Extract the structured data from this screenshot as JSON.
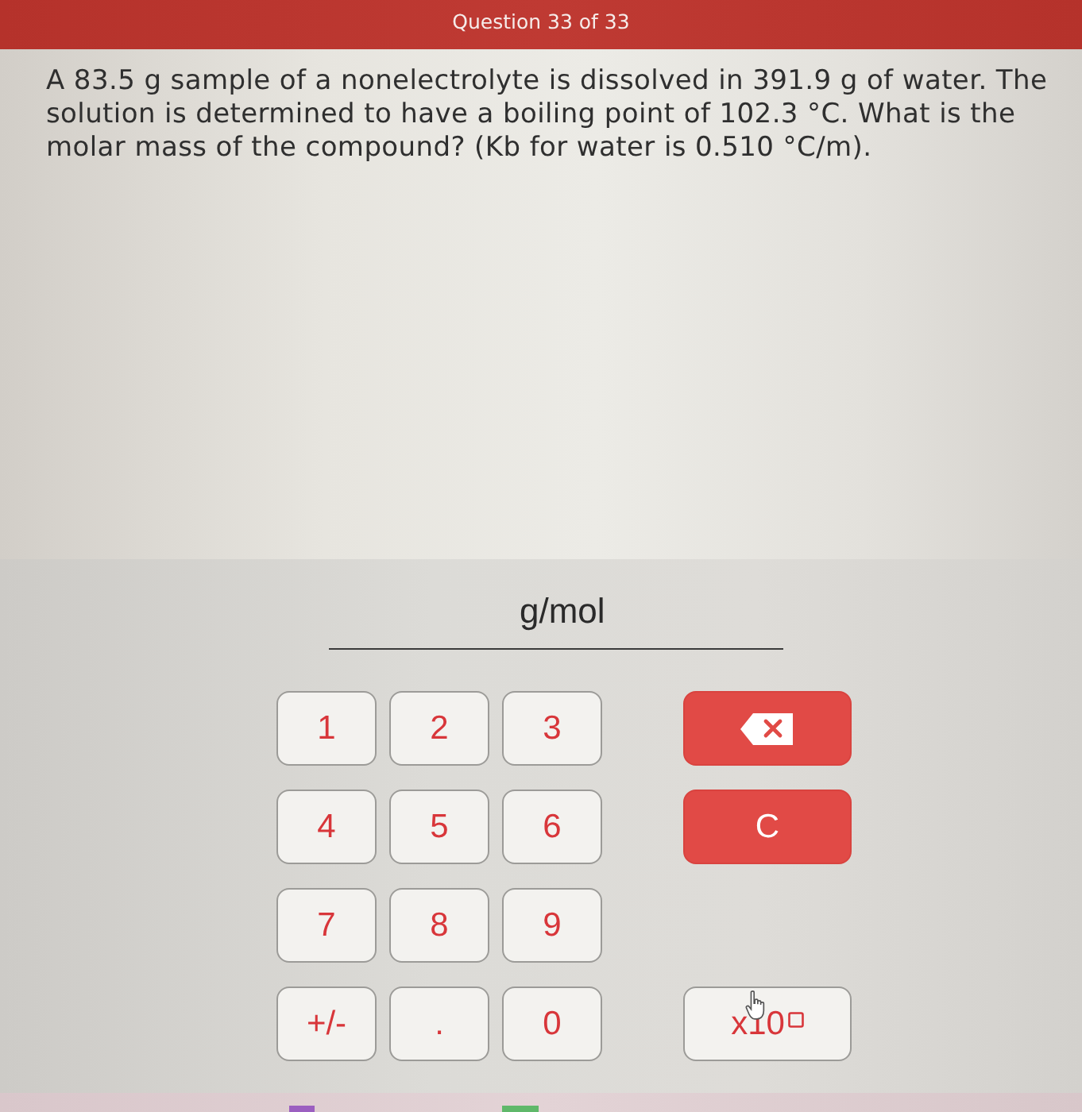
{
  "header": {
    "title": "Question 33 of 33"
  },
  "question": {
    "text": "A 83.5 g sample of a nonelectrolyte is dissolved in 391.9 g of water. The solution is determined to have a boiling point of 102.3 °C. What is the molar mass of the compound? (Kb for water is 0.510 °C/m)."
  },
  "answer": {
    "unit": "g/mol"
  },
  "keypad": {
    "rows": [
      [
        {
          "kind": "key",
          "label": "1"
        },
        {
          "kind": "key",
          "label": "2"
        },
        {
          "kind": "key",
          "label": "3"
        },
        {
          "kind": "backspace"
        }
      ],
      [
        {
          "kind": "key",
          "label": "4"
        },
        {
          "kind": "key",
          "label": "5"
        },
        {
          "kind": "key",
          "label": "6"
        },
        {
          "kind": "clear",
          "label": "C"
        }
      ],
      [
        {
          "kind": "key",
          "label": "7"
        },
        {
          "kind": "key",
          "label": "8"
        },
        {
          "kind": "key",
          "label": "9"
        }
      ],
      [
        {
          "kind": "key",
          "label": "+/-"
        },
        {
          "kind": "key",
          "label": "."
        },
        {
          "kind": "key",
          "label": "0"
        },
        {
          "kind": "exponent",
          "label": "x10"
        }
      ]
    ]
  }
}
